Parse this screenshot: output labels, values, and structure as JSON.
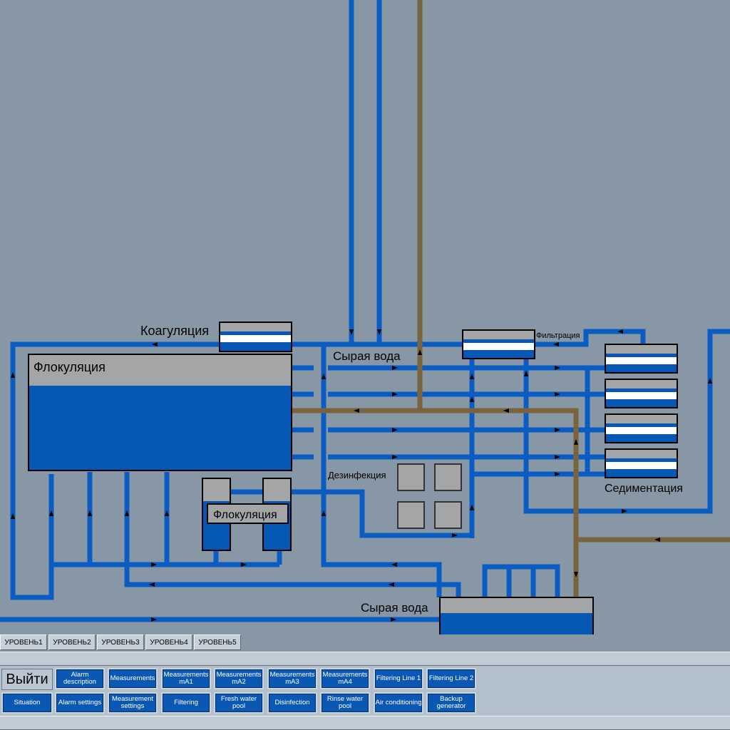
{
  "labels": {
    "coagulation": "Коагуляция",
    "flocculation_main": "Флокуляция",
    "flocculation_small": "Флокуляция",
    "raw_water_top": "Сырая вода",
    "filtration": "Фильтрация",
    "disinfection": "Дезинфекция",
    "sedimentation": "Седиментация",
    "raw_water_bottom": "Сырая вода"
  },
  "level_tabs": [
    "УРОВЕНЬ1",
    "УРОВЕНЬ2",
    "УРОВЕНЬ3",
    "УРОВЕНЬ4",
    "УРОВЕНЬ5"
  ],
  "nav": {
    "exit_label": "Выйти",
    "row1": [
      "Alarm description",
      "Measurements",
      "Measurements mA1",
      "Measurements mA2",
      "Measurements mA3",
      "Measurements mA4",
      "Filtering Line 1",
      "Filtering Line 2"
    ],
    "row2": [
      "Situation",
      "Alarm settings",
      "Measurement settings",
      "Filtering",
      "Fresh water pool",
      "Disinfection",
      "Rinse water pool",
      "Air conditioning",
      "Backup generator"
    ]
  },
  "colors": {
    "background": "#8797a5",
    "water_pipe": "#0a5cc2",
    "sludge_pipe": "#7a6440",
    "tank_water": "#0757b5",
    "tank_top": "#a3a5a7",
    "button_blue": "#0a58b3"
  }
}
